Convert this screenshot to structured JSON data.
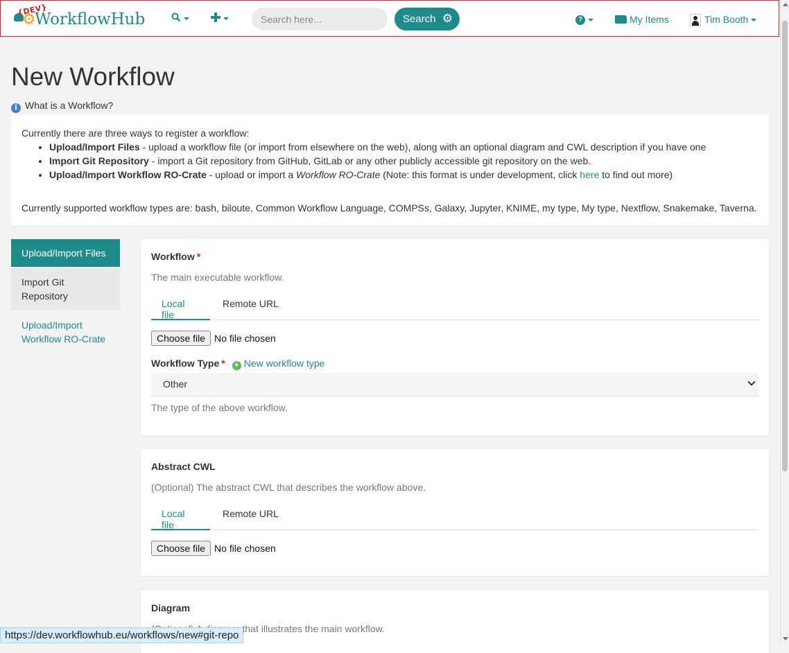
{
  "navbar": {
    "brand_badge": "{DEV}",
    "brand_name": "WorkflowHub",
    "search_placeholder": "Search here...",
    "search_button": "Search",
    "my_items": "My Items",
    "user_name": "Tim Booth"
  },
  "page": {
    "title": "New Workflow",
    "info_link": "What is a Workflow?"
  },
  "intro": {
    "lead": "Currently there are three ways to register a workflow:",
    "items": [
      {
        "title": "Upload/Import Files",
        "desc": " - upload a workflow file (or import from elsewhere on the web), along with an optional diagram and CWL description if you have one"
      },
      {
        "title": "Import Git Repository",
        "desc": " - import a Git repository from GitHub, GitLab or any other publicly accessible git repository on the web."
      },
      {
        "title": "Upload/Import Workflow RO-Crate",
        "desc_pre": " - upload or import a ",
        "desc_em": "Workflow RO-Crate",
        "desc_mid": " (Note: this format is under development, click ",
        "link": "here",
        "desc_post": " to find out more)"
      }
    ],
    "supported": "Currently supported workflow types are: bash, biloute, Common Workflow Language, COMPSs, Galaxy, Jupyter, KNIME, my type, My type, Nextflow, Snakemake, Taverna."
  },
  "sidenav": {
    "items": [
      {
        "label": "Upload/Import Files"
      },
      {
        "label": "Import Git Repository"
      },
      {
        "label": "Upload/Import Workflow RO-Crate"
      }
    ]
  },
  "workflow_panel": {
    "label": "Workflow",
    "required": "*",
    "help": "The main executable workflow.",
    "tab_local": "Local file",
    "tab_remote": "Remote URL",
    "choose_file": "Choose file",
    "file_status": "No file chosen",
    "type_label": "Workflow Type",
    "new_type_link": "New workflow type",
    "type_selected": "Other",
    "type_help": "The type of the above workflow."
  },
  "cwl_panel": {
    "label": "Abstract CWL",
    "help": "(Optional) The abstract CWL that describes the workflow above.",
    "tab_local": "Local file",
    "tab_remote": "Remote URL",
    "choose_file": "Choose file",
    "file_status": "No file chosen"
  },
  "diagram_panel": {
    "label": "Diagram",
    "help": "(Optional) A diagram that illustrates the main workflow."
  },
  "statusbar": {
    "url": "https://dev.workflowhub.eu/workflows/new#git-repo"
  }
}
